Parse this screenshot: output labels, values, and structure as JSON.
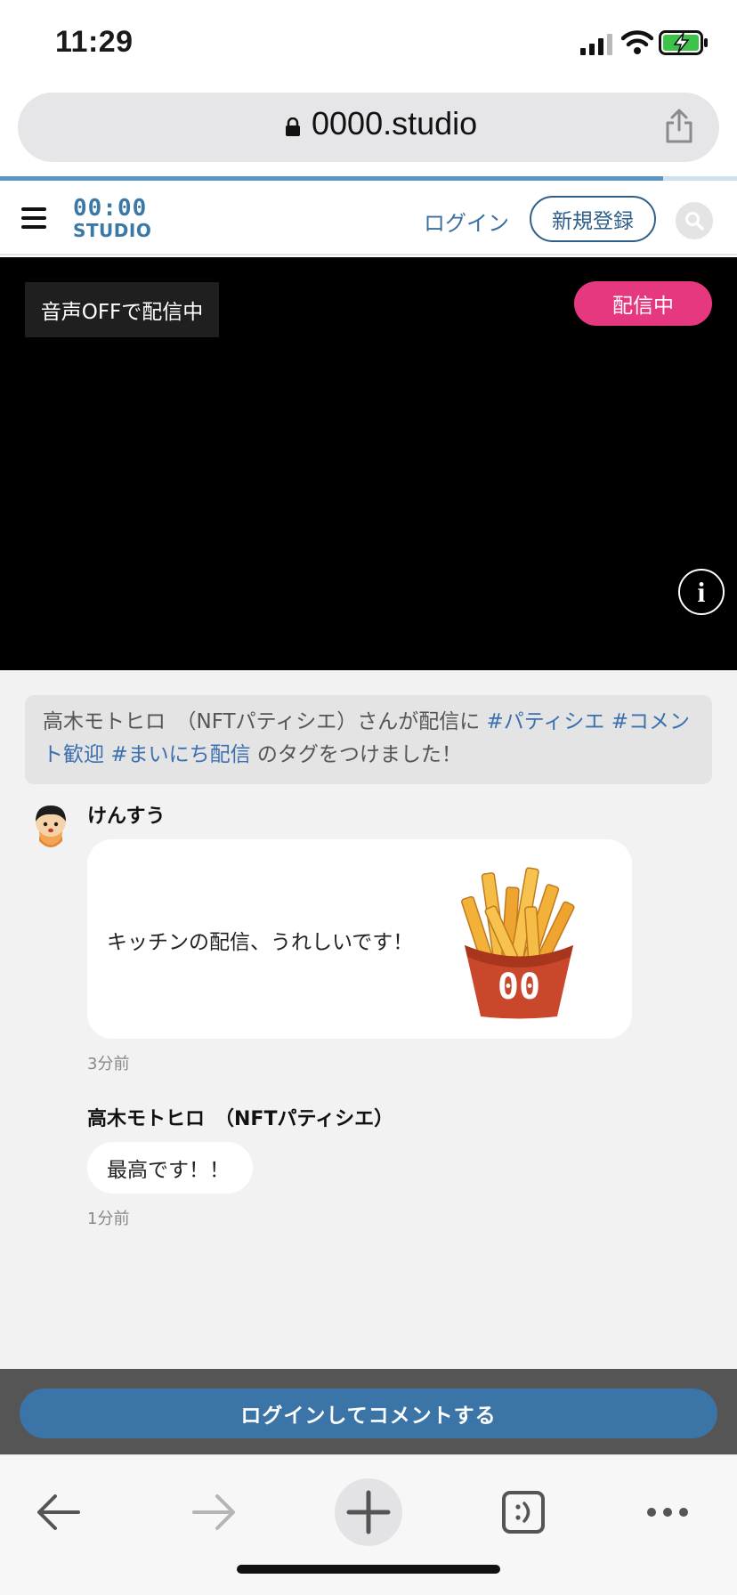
{
  "status_bar": {
    "time": "11:29"
  },
  "browser": {
    "url": "0000.studio",
    "load_progress_percent": 90
  },
  "header": {
    "logo_top": "00:00",
    "logo_bottom": "STUDIO",
    "login_label": "ログイン",
    "signup_label": "新規登録"
  },
  "video": {
    "audio_status": "音声OFFで配信中",
    "live_badge": "配信中",
    "info_glyph": "i"
  },
  "tag_notice": {
    "prefix": "高木モトヒロ　（NFTパティシエ）さんが配信に",
    "tags": [
      "#パティシエ",
      "#コメント歓迎",
      "#まいにち配信"
    ],
    "suffix": "のタグをつけました！"
  },
  "comments": [
    {
      "user": "けんすう",
      "text": "キッチンの配信、うれしいです！",
      "time": "3分前",
      "sticker_text": "00"
    },
    {
      "user": "高木モトヒロ　（NFTパティシエ）",
      "text": "最高です！！",
      "time": "1分前"
    }
  ],
  "comment_bar": {
    "login_to_comment": "ログインしてコメントする"
  },
  "colors": {
    "accent": "#3b74a7",
    "live": "#e6387f",
    "tag_link": "#3b6fb0"
  }
}
